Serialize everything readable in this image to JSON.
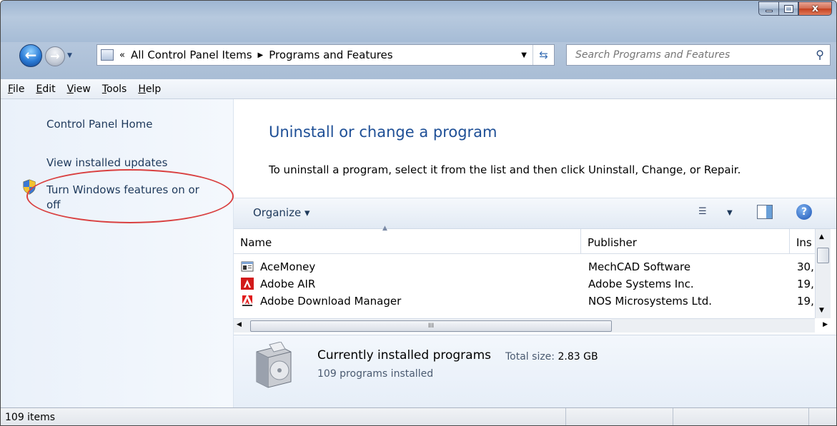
{
  "window": {
    "buttons": {
      "minimize": "",
      "maximize": "",
      "close": "x"
    }
  },
  "address": {
    "overflow": "«",
    "crumbs": [
      "All Control Panel Items",
      "Programs and Features"
    ]
  },
  "search": {
    "placeholder": "Search Programs and Features"
  },
  "menu": [
    "File",
    "Edit",
    "View",
    "Tools",
    "Help"
  ],
  "sidebar": {
    "links": [
      "Control Panel Home",
      "View installed updates",
      "Turn Windows features on or",
      "off"
    ]
  },
  "main": {
    "heading": "Uninstall or change a program",
    "description": "To uninstall a program, select it from the list and then click Uninstall, Change, or Repair."
  },
  "toolbar": {
    "organize": "Organize ▾",
    "help": "?"
  },
  "table": {
    "columns": [
      "Name",
      "Publisher",
      "Ins"
    ],
    "rows": [
      {
        "name": "AceMoney",
        "publisher": "MechCAD Software",
        "installed": "30,"
      },
      {
        "name": "Adobe AIR",
        "publisher": "Adobe Systems Inc.",
        "installed": "19,"
      },
      {
        "name": "Adobe Download Manager",
        "publisher": "NOS Microsystems Ltd.",
        "installed": "19,"
      }
    ]
  },
  "scrollbar": {
    "grip": "III"
  },
  "details": {
    "title": "Currently installed programs",
    "size_label": "Total size:",
    "size_value": "2.83 GB",
    "count": "109 programs installed"
  },
  "statusbar": {
    "items": "109 items"
  },
  "colors": {
    "accent_link": "#1e395b",
    "heading": "#1e4f96",
    "highlight_oval": "#d94040"
  }
}
